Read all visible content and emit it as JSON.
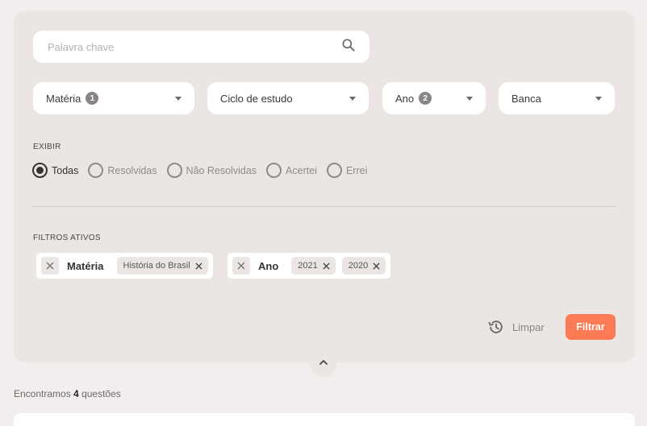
{
  "search": {
    "placeholder": "Palavra chave",
    "value": ""
  },
  "dropdowns": [
    {
      "label": "Matéria",
      "badge": "1"
    },
    {
      "label": "Ciclo de estudo",
      "badge": ""
    },
    {
      "label": "Ano",
      "badge": "2"
    },
    {
      "label": "Banca",
      "badge": ""
    }
  ],
  "exibir": {
    "label": "EXIBIR",
    "options": [
      "Todas",
      "Resolvidas",
      "Não Resolvidas",
      "Acertei",
      "Errei"
    ],
    "selected": "Todas"
  },
  "filtros_ativos": {
    "label": "FILTROS ATIVOS",
    "groups": [
      {
        "name": "Matéria",
        "values": [
          "História do Brasil"
        ]
      },
      {
        "name": "Ano",
        "values": [
          "2021",
          "2020"
        ]
      }
    ]
  },
  "actions": {
    "clear_label": "Limpar",
    "filter_label": "Filtrar"
  },
  "results": {
    "prefix": "Encontramos",
    "count": "4",
    "suffix": "questões"
  },
  "colors": {
    "accent": "#fc7b55",
    "panel": "#ebe5e3",
    "background": "#f2eeed"
  },
  "icons": {
    "search": "search-icon",
    "caret": "caret-down-icon",
    "close": "close-icon",
    "history": "history-icon",
    "collapse": "chevron-up-icon"
  }
}
